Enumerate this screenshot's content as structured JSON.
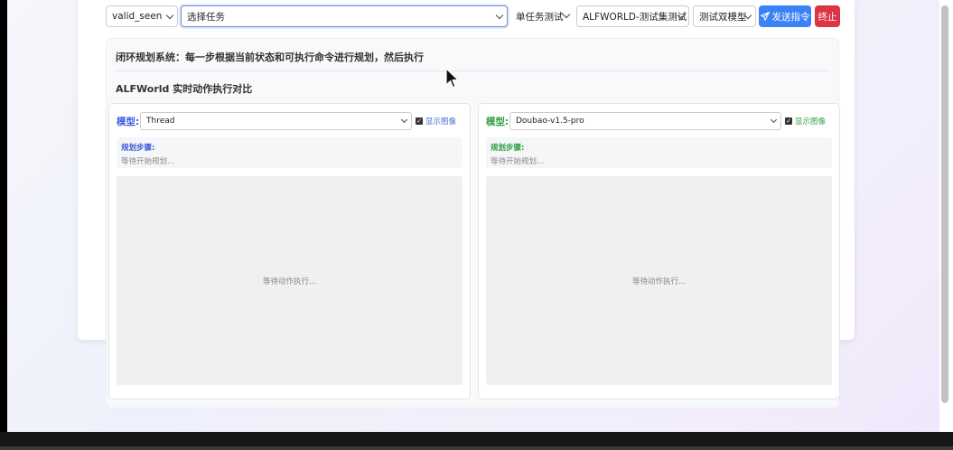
{
  "toolbar": {
    "split_select": "valid_seen",
    "task_select_placeholder": "选择任务",
    "mode_select": "单任务测试",
    "dataset_select": "ALFWORLD-测试集测试",
    "model_mode_select": "测试双模型",
    "send_button": "发送指令",
    "stop_button": "终止"
  },
  "panel": {
    "description": "闭环规划系统：每一步根据当前状态和可执行命令进行规划，然后执行",
    "comparison_title": "ALFWorld 实时动作执行对比"
  },
  "columns": [
    {
      "model_label": "模型:",
      "model_value": "Thread",
      "show_image_label": "显示图像",
      "show_image_checked": true,
      "steps_title": "规划步骤:",
      "steps_status": "等待开始规划...",
      "image_status": "等待动作执行..."
    },
    {
      "model_label": "模型:",
      "model_value": "Doubao-v1.5-pro",
      "show_image_label": "显示图像",
      "show_image_checked": true,
      "steps_title": "规划步骤:",
      "steps_status": "等待开始规划...",
      "image_status": "等待动作执行..."
    }
  ],
  "colors": {
    "send_button": "#3b82f6",
    "stop_button": "#dc3545",
    "model_a_accent": "#3b5bdb",
    "model_b_accent": "#2f9e44"
  },
  "icons": {
    "send": "paper-plane-icon",
    "cursor": "mouse-pointer-icon"
  }
}
